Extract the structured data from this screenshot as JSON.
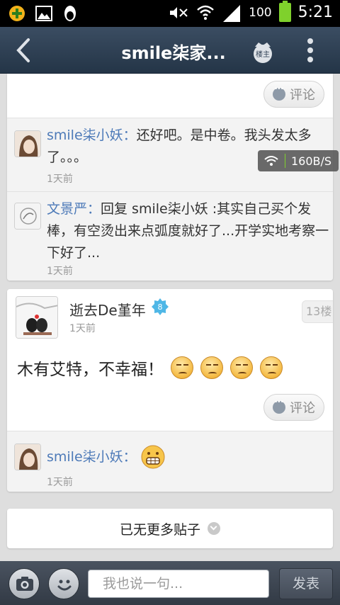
{
  "status_bar": {
    "battery_level": "100",
    "time": "5:21"
  },
  "header": {
    "title": "smile柒家...",
    "host_label": "楼主"
  },
  "network_speed": "160B/S",
  "thread_top": {
    "comment_label": "评论",
    "replies": [
      {
        "author": "smile柒小妖：",
        "text": "还好吧。是中卷。我头发太多了。。。",
        "time": "1天前"
      },
      {
        "author": "文景严：",
        "text": "回复 smile柒小妖 :其实自己买个发棒，有空烫出来点弧度就好了...开学实地考察一下好了...",
        "time": "1天前"
      }
    ]
  },
  "post": {
    "author": "逝去De堇年",
    "level": "8",
    "time": "1天前",
    "floor": "13楼",
    "content": "木有艾特，不幸福！",
    "emoji_icons": [
      "sad-face-emoji",
      "sad-face-emoji",
      "sad-face-emoji",
      "sad-face-emoji"
    ],
    "comment_label": "评论",
    "replies": [
      {
        "author": "smile柒小妖：",
        "emoji": "grimace-emoji",
        "time": "1天前"
      }
    ]
  },
  "no_more_text": "已无更多贴子",
  "composer": {
    "placeholder": "我也说一句...",
    "send_label": "发表"
  },
  "colors": {
    "title_bar": "#2e3f53",
    "author_link": "#4d7ab8",
    "battery": "#7fd12c",
    "level_badge": "#4fb7e6"
  }
}
